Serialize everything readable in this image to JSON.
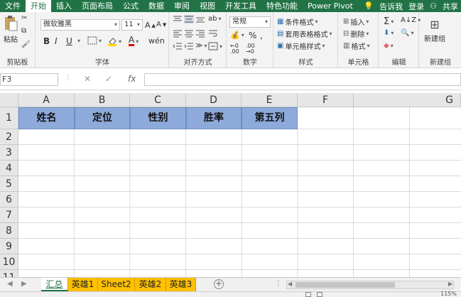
{
  "menu": {
    "tabs": [
      "文件",
      "开始",
      "插入",
      "页面布局",
      "公式",
      "数据",
      "审阅",
      "视图",
      "开发工具",
      "特色功能",
      "Power Pivot"
    ],
    "active_index": 1,
    "tell_me": "告诉我",
    "login": "登录",
    "share": "共享"
  },
  "ribbon": {
    "clipboard": {
      "paste": "粘贴",
      "label": "剪贴板"
    },
    "font": {
      "name": "微软雅黑",
      "size": "11",
      "label": "字体",
      "bold": "B",
      "italic": "I",
      "underline": "U"
    },
    "alignment": {
      "label": "对齐方式"
    },
    "number": {
      "format": "常规",
      "percent": "%",
      "label": "数字"
    },
    "styles": {
      "conditional": "条件格式",
      "table_format": "套用表格格式",
      "cell_style": "单元格样式",
      "label": "样式"
    },
    "cells": {
      "insert": "插入",
      "delete": "删除",
      "format": "格式",
      "label": "单元格"
    },
    "editing": {
      "label": "编辑"
    },
    "newgroup": {
      "button": "新建组",
      "label": "新建组"
    }
  },
  "formula_bar": {
    "name_box": "F3",
    "cancel": "✕",
    "enter": "✓",
    "fx": "fx",
    "value": ""
  },
  "sheet": {
    "columns": [
      "A",
      "B",
      "C",
      "D",
      "E",
      "F",
      "G"
    ],
    "rows": [
      "1",
      "2",
      "3",
      "4",
      "5",
      "6",
      "7",
      "8",
      "9",
      "10",
      "11"
    ],
    "header_cells": [
      "姓名",
      "定位",
      "性别",
      "胜率",
      "第五列"
    ],
    "header_fill": "#8eaadb"
  },
  "tabs": {
    "sheets": [
      "汇总",
      "英雄1",
      "Sheet2",
      "英雄2",
      "英雄3"
    ],
    "active_index": 0,
    "tab_color": "#ffc000"
  },
  "status": {
    "zoom": "115%"
  }
}
